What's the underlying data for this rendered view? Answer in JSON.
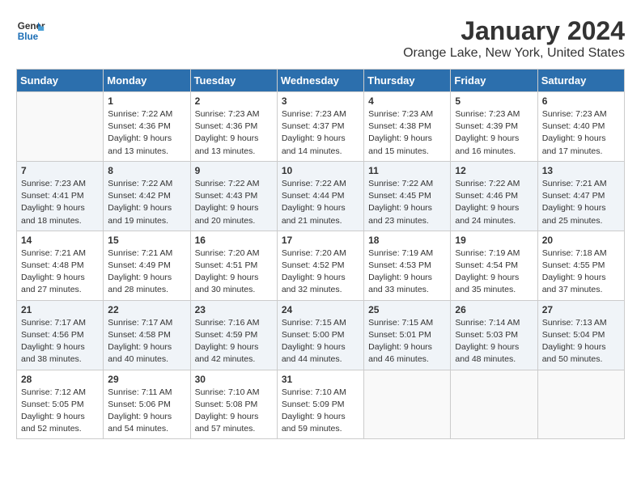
{
  "header": {
    "logo_line1": "General",
    "logo_line2": "Blue",
    "title": "January 2024",
    "subtitle": "Orange Lake, New York, United States"
  },
  "days_of_week": [
    "Sunday",
    "Monday",
    "Tuesday",
    "Wednesday",
    "Thursday",
    "Friday",
    "Saturday"
  ],
  "weeks": [
    [
      {
        "day": "",
        "empty": true
      },
      {
        "day": "1",
        "sunrise": "Sunrise: 7:22 AM",
        "sunset": "Sunset: 4:36 PM",
        "daylight": "Daylight: 9 hours and 13 minutes."
      },
      {
        "day": "2",
        "sunrise": "Sunrise: 7:23 AM",
        "sunset": "Sunset: 4:36 PM",
        "daylight": "Daylight: 9 hours and 13 minutes."
      },
      {
        "day": "3",
        "sunrise": "Sunrise: 7:23 AM",
        "sunset": "Sunset: 4:37 PM",
        "daylight": "Daylight: 9 hours and 14 minutes."
      },
      {
        "day": "4",
        "sunrise": "Sunrise: 7:23 AM",
        "sunset": "Sunset: 4:38 PM",
        "daylight": "Daylight: 9 hours and 15 minutes."
      },
      {
        "day": "5",
        "sunrise": "Sunrise: 7:23 AM",
        "sunset": "Sunset: 4:39 PM",
        "daylight": "Daylight: 9 hours and 16 minutes."
      },
      {
        "day": "6",
        "sunrise": "Sunrise: 7:23 AM",
        "sunset": "Sunset: 4:40 PM",
        "daylight": "Daylight: 9 hours and 17 minutes."
      }
    ],
    [
      {
        "day": "7",
        "sunrise": "Sunrise: 7:23 AM",
        "sunset": "Sunset: 4:41 PM",
        "daylight": "Daylight: 9 hours and 18 minutes."
      },
      {
        "day": "8",
        "sunrise": "Sunrise: 7:22 AM",
        "sunset": "Sunset: 4:42 PM",
        "daylight": "Daylight: 9 hours and 19 minutes."
      },
      {
        "day": "9",
        "sunrise": "Sunrise: 7:22 AM",
        "sunset": "Sunset: 4:43 PM",
        "daylight": "Daylight: 9 hours and 20 minutes."
      },
      {
        "day": "10",
        "sunrise": "Sunrise: 7:22 AM",
        "sunset": "Sunset: 4:44 PM",
        "daylight": "Daylight: 9 hours and 21 minutes."
      },
      {
        "day": "11",
        "sunrise": "Sunrise: 7:22 AM",
        "sunset": "Sunset: 4:45 PM",
        "daylight": "Daylight: 9 hours and 23 minutes."
      },
      {
        "day": "12",
        "sunrise": "Sunrise: 7:22 AM",
        "sunset": "Sunset: 4:46 PM",
        "daylight": "Daylight: 9 hours and 24 minutes."
      },
      {
        "day": "13",
        "sunrise": "Sunrise: 7:21 AM",
        "sunset": "Sunset: 4:47 PM",
        "daylight": "Daylight: 9 hours and 25 minutes."
      }
    ],
    [
      {
        "day": "14",
        "sunrise": "Sunrise: 7:21 AM",
        "sunset": "Sunset: 4:48 PM",
        "daylight": "Daylight: 9 hours and 27 minutes."
      },
      {
        "day": "15",
        "sunrise": "Sunrise: 7:21 AM",
        "sunset": "Sunset: 4:49 PM",
        "daylight": "Daylight: 9 hours and 28 minutes."
      },
      {
        "day": "16",
        "sunrise": "Sunrise: 7:20 AM",
        "sunset": "Sunset: 4:51 PM",
        "daylight": "Daylight: 9 hours and 30 minutes."
      },
      {
        "day": "17",
        "sunrise": "Sunrise: 7:20 AM",
        "sunset": "Sunset: 4:52 PM",
        "daylight": "Daylight: 9 hours and 32 minutes."
      },
      {
        "day": "18",
        "sunrise": "Sunrise: 7:19 AM",
        "sunset": "Sunset: 4:53 PM",
        "daylight": "Daylight: 9 hours and 33 minutes."
      },
      {
        "day": "19",
        "sunrise": "Sunrise: 7:19 AM",
        "sunset": "Sunset: 4:54 PM",
        "daylight": "Daylight: 9 hours and 35 minutes."
      },
      {
        "day": "20",
        "sunrise": "Sunrise: 7:18 AM",
        "sunset": "Sunset: 4:55 PM",
        "daylight": "Daylight: 9 hours and 37 minutes."
      }
    ],
    [
      {
        "day": "21",
        "sunrise": "Sunrise: 7:17 AM",
        "sunset": "Sunset: 4:56 PM",
        "daylight": "Daylight: 9 hours and 38 minutes."
      },
      {
        "day": "22",
        "sunrise": "Sunrise: 7:17 AM",
        "sunset": "Sunset: 4:58 PM",
        "daylight": "Daylight: 9 hours and 40 minutes."
      },
      {
        "day": "23",
        "sunrise": "Sunrise: 7:16 AM",
        "sunset": "Sunset: 4:59 PM",
        "daylight": "Daylight: 9 hours and 42 minutes."
      },
      {
        "day": "24",
        "sunrise": "Sunrise: 7:15 AM",
        "sunset": "Sunset: 5:00 PM",
        "daylight": "Daylight: 9 hours and 44 minutes."
      },
      {
        "day": "25",
        "sunrise": "Sunrise: 7:15 AM",
        "sunset": "Sunset: 5:01 PM",
        "daylight": "Daylight: 9 hours and 46 minutes."
      },
      {
        "day": "26",
        "sunrise": "Sunrise: 7:14 AM",
        "sunset": "Sunset: 5:03 PM",
        "daylight": "Daylight: 9 hours and 48 minutes."
      },
      {
        "day": "27",
        "sunrise": "Sunrise: 7:13 AM",
        "sunset": "Sunset: 5:04 PM",
        "daylight": "Daylight: 9 hours and 50 minutes."
      }
    ],
    [
      {
        "day": "28",
        "sunrise": "Sunrise: 7:12 AM",
        "sunset": "Sunset: 5:05 PM",
        "daylight": "Daylight: 9 hours and 52 minutes."
      },
      {
        "day": "29",
        "sunrise": "Sunrise: 7:11 AM",
        "sunset": "Sunset: 5:06 PM",
        "daylight": "Daylight: 9 hours and 54 minutes."
      },
      {
        "day": "30",
        "sunrise": "Sunrise: 7:10 AM",
        "sunset": "Sunset: 5:08 PM",
        "daylight": "Daylight: 9 hours and 57 minutes."
      },
      {
        "day": "31",
        "sunrise": "Sunrise: 7:10 AM",
        "sunset": "Sunset: 5:09 PM",
        "daylight": "Daylight: 9 hours and 59 minutes."
      },
      {
        "day": "",
        "empty": true
      },
      {
        "day": "",
        "empty": true
      },
      {
        "day": "",
        "empty": true
      }
    ]
  ]
}
